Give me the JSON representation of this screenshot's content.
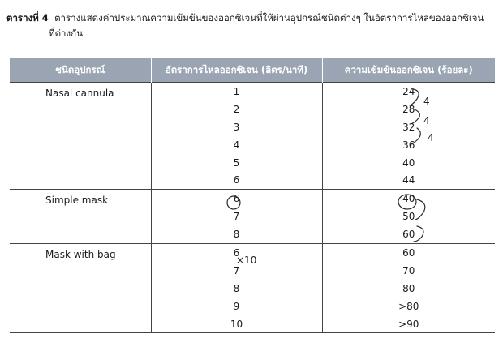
{
  "caption": {
    "label": "ตารางที่ 4",
    "line1": "ตารางแสดงค่าประมาณความเข้มข้นของออกซิเจนที่ให้ผ่านอุปกรณ์ชนิดต่างๆ  ในอัตราการไหลของออกซิเจน",
    "line2": "ที่ต่างกัน"
  },
  "table": {
    "headers": [
      "ชนิดอุปกรณ์",
      "อัตราการไหลออกซิเจน (ลิตร/นาที)",
      "ความเข้มข้นออกซิเจน (ร้อยละ)"
    ],
    "groups": [
      {
        "device": "Nasal cannula",
        "rows": [
          [
            "1",
            "24"
          ],
          [
            "2",
            "28"
          ],
          [
            "3",
            "32"
          ],
          [
            "4",
            "36"
          ],
          [
            "5",
            "40"
          ],
          [
            "6",
            "44"
          ]
        ]
      },
      {
        "device": "Simple mask",
        "rows": [
          [
            "6",
            "40"
          ],
          [
            "7",
            "50"
          ],
          [
            "8",
            "60"
          ]
        ]
      },
      {
        "device": "Mask with bag",
        "rows": [
          [
            "6",
            "60"
          ],
          [
            "7",
            "70"
          ],
          [
            "8",
            "80"
          ],
          [
            "9",
            ">80"
          ],
          [
            "10",
            ">90"
          ]
        ]
      }
    ]
  },
  "handwriting": {
    "nasal_step_1": "4",
    "nasal_step_2": "4",
    "nasal_step_3": "4",
    "mask_bag_note": "×10"
  }
}
